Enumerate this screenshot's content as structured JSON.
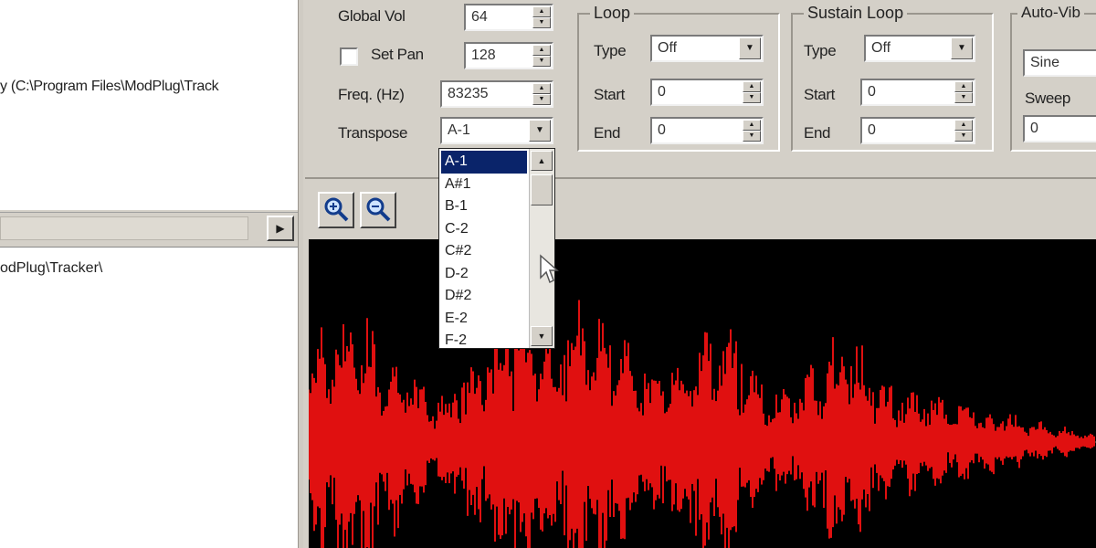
{
  "left_pane": {
    "top_path_text": "y (C:\\Program Files\\ModPlug\\Track",
    "bottom_path_text": "odPlug\\Tracker\\",
    "scroll_right_glyph": "▶"
  },
  "general": {
    "global_vol_label": "Global Vol",
    "global_vol_value": "64",
    "set_pan_label": "Set Pan",
    "set_pan_checked": false,
    "set_pan_value": "128",
    "freq_label": "Freq. (Hz)",
    "freq_value": "83235",
    "transpose_label": "Transpose",
    "transpose_value": "A-1"
  },
  "loop": {
    "title": "Loop",
    "type_label": "Type",
    "type_value": "Off",
    "start_label": "Start",
    "start_value": "0",
    "end_label": "End",
    "end_value": "0"
  },
  "sustain_loop": {
    "title": "Sustain Loop",
    "type_label": "Type",
    "type_value": "Off",
    "start_label": "Start",
    "start_value": "0",
    "end_label": "End",
    "end_value": "0"
  },
  "auto_vibrato": {
    "title": "Auto-Vib",
    "waveform_value": "Sine",
    "sweep_label": "Sweep",
    "sweep_value": "0"
  },
  "transpose_dropdown": {
    "options": [
      "A-1",
      "A#1",
      "B-1",
      "C-2",
      "C#2",
      "D-2",
      "D#2",
      "E-2",
      "F-2"
    ],
    "selected_index": 0
  },
  "waveform_toolbar": {
    "zoom_in_icon": "zoom-in-icon",
    "zoom_out_icon": "zoom-out-icon"
  },
  "colors": {
    "waveform": "#e01010",
    "waveform_bg": "#000000",
    "selection": "#0a246a",
    "window_face": "#d4d0c8"
  }
}
